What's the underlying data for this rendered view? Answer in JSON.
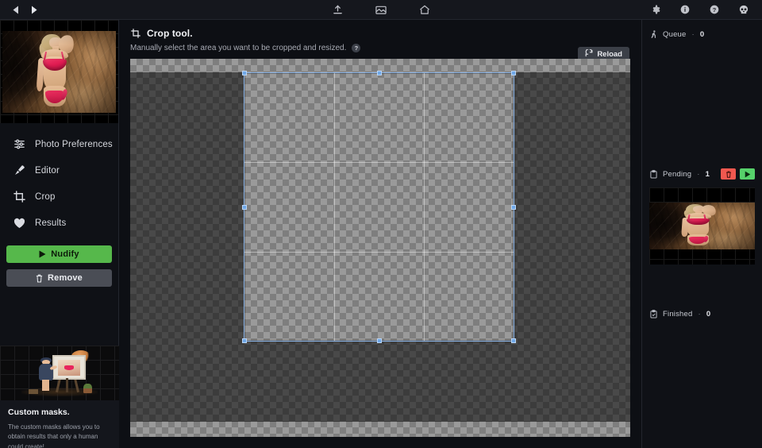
{
  "topbar": {
    "nav_prev": "◀",
    "nav_next": "▶",
    "icons": [
      {
        "name": "upload-icon",
        "title": "Upload"
      },
      {
        "name": "gallery-icon",
        "title": "Gallery"
      },
      {
        "name": "home-icon",
        "title": "Home"
      }
    ],
    "right_icons": [
      {
        "name": "gear-icon",
        "title": "Settings"
      },
      {
        "name": "info-icon",
        "title": "Information"
      },
      {
        "name": "help-icon",
        "title": "Help"
      },
      {
        "name": "skull-icon",
        "title": "Account"
      }
    ]
  },
  "sidebar": {
    "thumbnail_alt": "Selected photo thumbnail",
    "items": [
      {
        "label": "Photo Preferences",
        "icon": "sliders-icon"
      },
      {
        "label": "Editor",
        "icon": "brush-icon"
      },
      {
        "label": "Crop",
        "icon": "crop-icon"
      },
      {
        "label": "Results",
        "icon": "heart-icon"
      }
    ],
    "nudify_label": "Nudify",
    "remove_label": "Remove",
    "promo": {
      "title": "Custom masks.",
      "text": "The custom masks allows you to obtain results that only a human could create!"
    }
  },
  "main": {
    "title": "Crop tool.",
    "subtitle": "Manually select the area you want to be cropped and resized.",
    "help_glyph": "?",
    "reload_label": "Reload"
  },
  "right_panel": {
    "queue": {
      "label": "Queue",
      "separator": "·",
      "count": "0",
      "icon": "runner-icon"
    },
    "pending": {
      "label": "Pending",
      "separator": "·",
      "count": "1",
      "icon": "clipboard-icon"
    },
    "finished": {
      "label": "Finished",
      "separator": "·",
      "count": "0",
      "icon": "clipboard-check-icon"
    },
    "pending_actions": [
      {
        "name": "delete-pending-button",
        "icon": "trash-icon"
      },
      {
        "name": "run-pending-button",
        "icon": "play-icon"
      }
    ],
    "queue_thumbnail_alt": "Pending job thumbnail"
  },
  "colors": {
    "accent_green": "#56b84b",
    "danger_red": "#f0584f",
    "run_green": "#56d16a",
    "crop_border": "#8ab4e8",
    "panel_bg": "#0f1116",
    "topbar_bg": "#15171d"
  }
}
